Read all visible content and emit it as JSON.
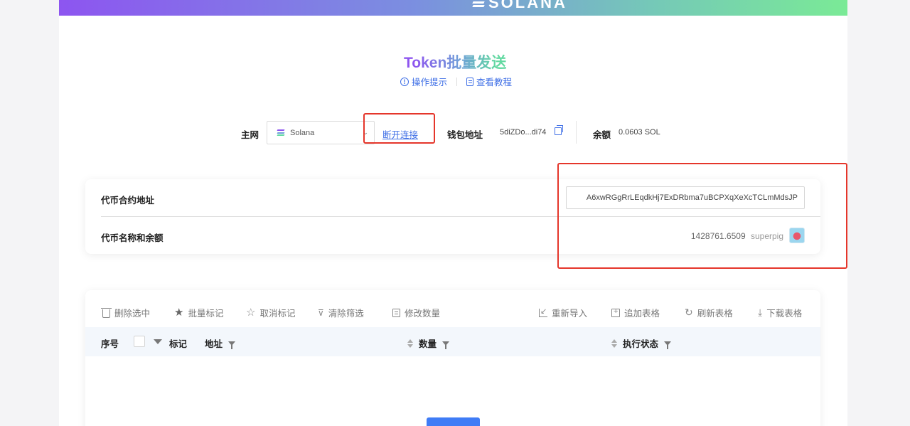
{
  "banner": {
    "brand": "SOLANA"
  },
  "page": {
    "title": "Token批量发送"
  },
  "sublinks": {
    "tips": "操作提示",
    "tutorial": "查看教程"
  },
  "network": {
    "label": "主网",
    "selected": "Solana",
    "disconnect": "断开连接",
    "wallet_label": "钱包地址",
    "wallet_address": "5diZDo...di74",
    "balance_label": "余额",
    "balance_value": "0.0603 SOL"
  },
  "token": {
    "contract_label": "代币合约地址",
    "contract_value": "A6xwRGgRrLEqdkHj7ExDRbma7uBCPXqXeXcTCLmMdsJP",
    "name_label": "代币名称和余额",
    "balance": "1428761.6509",
    "symbol": "superpig"
  },
  "toolbar": {
    "delete_selected": "删除选中",
    "batch_mark": "批量标记",
    "cancel_mark": "取消标记",
    "clear_filter": "清除筛选",
    "edit_quantity": "修改数量",
    "reimport": "重新导入",
    "append_table": "追加表格",
    "refresh_table": "刷新表格",
    "download_table": "下载表格"
  },
  "table": {
    "columns": {
      "index": "序号",
      "mark": "标记",
      "address": "地址",
      "quantity": "数量",
      "status": "执行状态"
    }
  },
  "colors": {
    "accent": "#3f6fe6",
    "highlight": "#e5362b",
    "header_bg": "#f3f7fc"
  }
}
